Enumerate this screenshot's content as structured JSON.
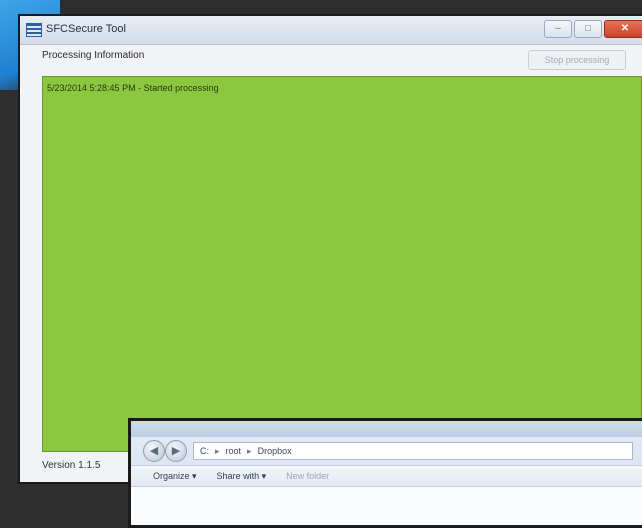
{
  "app_window": {
    "title": "SFCSecure Tool",
    "controls": {
      "minimize": "–",
      "maximize": "□",
      "close": "✕"
    },
    "section_label": "Processing Information",
    "stop_button": "Stop processing",
    "log_lines": [
      "5/23/2014 5:28:45 PM - Started processing"
    ],
    "version": "Version 1.1.5"
  },
  "explorer": {
    "breadcrumbs": [
      "C:",
      "root",
      "Dropbox"
    ],
    "commands": [
      {
        "label": "Organize ▾"
      },
      {
        "label": "Share with ▾"
      },
      {
        "label": "New folder"
      }
    ]
  },
  "colors": {
    "log_background": "#8dc63f",
    "desktop_accent": "#1e7fd0"
  }
}
